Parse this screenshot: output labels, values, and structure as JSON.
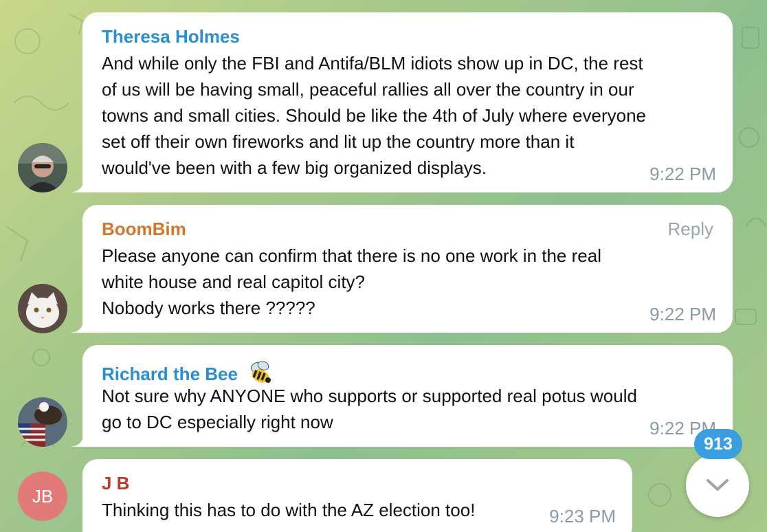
{
  "colors": {
    "sender_blue": "#2a8fd0",
    "sender_orange": "#d2772c",
    "sender_red": "#c0392b",
    "avatar_jb_bg": "#e37a7a",
    "badge_bg": "#3a9fe0"
  },
  "messages": [
    {
      "sender": "Theresa Holmes",
      "text": "And while only the FBI and Antifa/BLM idiots show up in DC, the rest\nof us will be having small, peaceful rallies all over the country in our\ntowns and small cities. Should be like the 4th of July where everyone\nset off their own fireworks and lit up the country more than it\nwould've been with a few big organized displays.",
      "time": "9:22 PM",
      "avatar_icon": "user-photo-icon"
    },
    {
      "sender": "BoomBim",
      "reply_label": "Reply",
      "text": "Please anyone can confirm that there is no one work in the real\nwhite house and real capitol city?\nNobody works there ?????",
      "time": "9:22 PM",
      "avatar_icon": "cat-photo-icon"
    },
    {
      "sender": "Richard the Bee",
      "sender_emoji": "bee-icon",
      "text": "Not sure why ANYONE who supports or supported real potus would\ngo to DC especially right now",
      "time": "9:22 PM",
      "avatar_icon": "eagle-flag-photo-icon"
    },
    {
      "sender": "J B",
      "avatar_initials": "JB",
      "text": "Thinking this has to do with the AZ election too!",
      "time": "9:23 PM"
    }
  ],
  "scroll": {
    "unread_count": "913",
    "icon": "chevron-down-icon"
  }
}
